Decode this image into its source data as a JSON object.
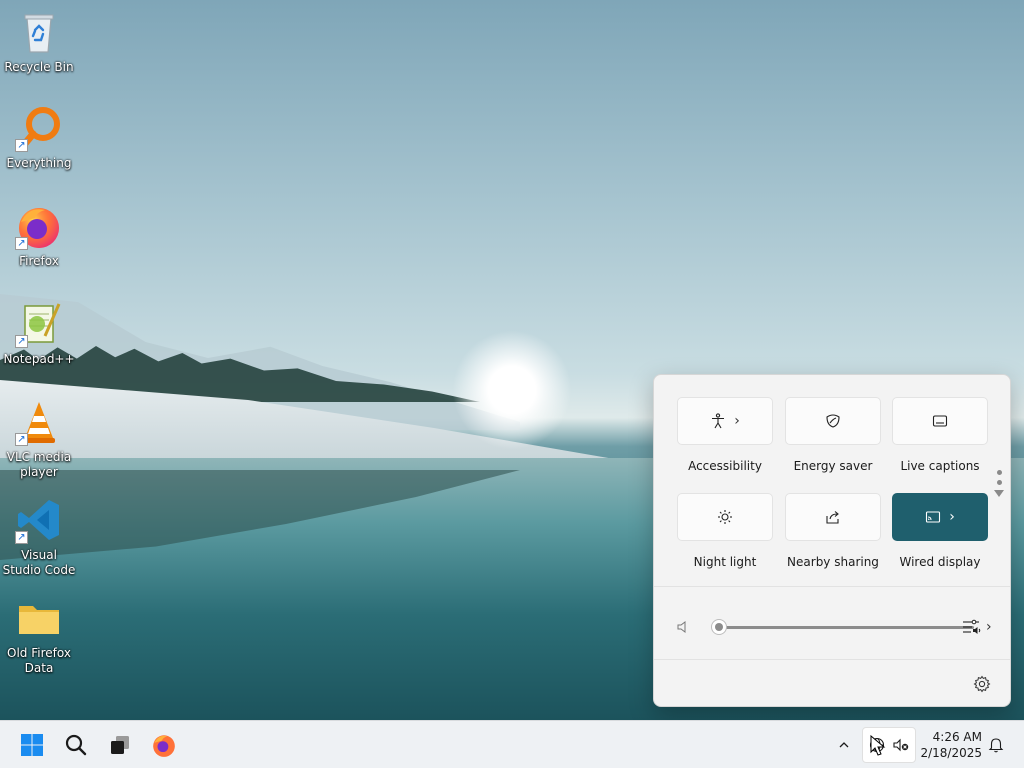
{
  "desktop": {
    "icons": [
      {
        "label": "Recycle Bin",
        "icon": "recycle-bin-icon"
      },
      {
        "label": "Everything",
        "icon": "everything-search-icon"
      },
      {
        "label": "Firefox",
        "icon": "firefox-icon"
      },
      {
        "label": "Notepad++",
        "icon": "notepad-plus-plus-icon"
      },
      {
        "label": "VLC media player",
        "icon": "vlc-icon"
      },
      {
        "label": "Visual Studio Code",
        "icon": "vscode-icon"
      },
      {
        "label": "Old Firefox Data",
        "icon": "folder-icon"
      }
    ]
  },
  "quick_settings": {
    "tiles": [
      {
        "label": "Accessibility",
        "icon": "accessibility-icon",
        "active": false,
        "has_chevron": true
      },
      {
        "label": "Energy saver",
        "icon": "energy-saver-icon",
        "active": false,
        "has_chevron": false
      },
      {
        "label": "Live captions",
        "icon": "live-captions-icon",
        "active": false,
        "has_chevron": false
      },
      {
        "label": "Night light",
        "icon": "night-light-icon",
        "active": false,
        "has_chevron": false
      },
      {
        "label": "Nearby sharing",
        "icon": "nearby-sharing-icon",
        "active": false,
        "has_chevron": false
      },
      {
        "label": "Wired display",
        "icon": "cast-icon",
        "active": true,
        "has_chevron": true
      }
    ],
    "volume": {
      "level": 0,
      "muted_icon": "speaker-icon"
    },
    "accent_color": "#1f5f6d"
  },
  "taskbar": {
    "apps": [
      "start-icon",
      "search-icon",
      "task-view-icon",
      "firefox-icon"
    ],
    "tray": {
      "time": "4:26 AM",
      "date": "2/18/2025"
    }
  }
}
